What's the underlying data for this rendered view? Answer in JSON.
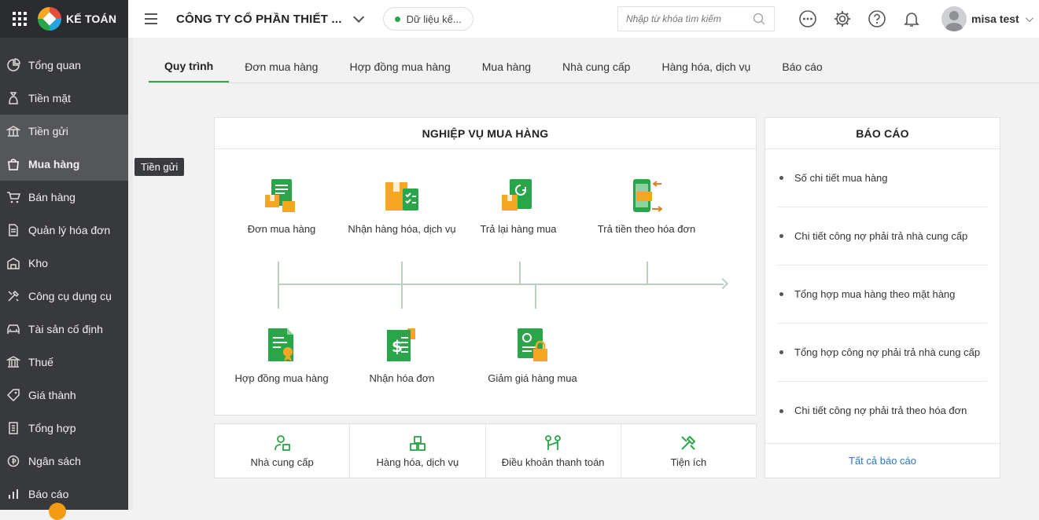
{
  "brand": {
    "name": "KẾ TOÁN"
  },
  "sidebar": {
    "items": [
      {
        "label": "Tổng quan",
        "icon": "chart-pie-icon"
      },
      {
        "label": "Tiền mặt",
        "icon": "money-bag-icon"
      },
      {
        "label": "Tiền gửi",
        "icon": "bank-icon"
      },
      {
        "label": "Mua hàng",
        "icon": "shopping-bag-icon"
      },
      {
        "label": "Bán hàng",
        "icon": "cart-icon"
      },
      {
        "label": "Quản lý hóa đơn",
        "icon": "invoice-icon"
      },
      {
        "label": "Kho",
        "icon": "warehouse-icon"
      },
      {
        "label": "Công cụ dụng cụ",
        "icon": "tools-icon"
      },
      {
        "label": "Tài sản cố định",
        "icon": "car-icon"
      },
      {
        "label": "Thuế",
        "icon": "government-icon"
      },
      {
        "label": "Giá thành",
        "icon": "price-tag-icon"
      },
      {
        "label": "Tổng hợp",
        "icon": "ledger-icon"
      },
      {
        "label": "Ngân sách",
        "icon": "budget-icon"
      },
      {
        "label": "Báo cáo",
        "icon": "bar-chart-icon"
      }
    ],
    "tooltip": "Tiền gửi"
  },
  "header": {
    "company": "CÔNG TY CỔ PHẦN THIẾT ...",
    "data_label": "Dữ liệu kế...",
    "search_placeholder": "Nhập từ khóa tìm kiếm",
    "user_name": "misa test"
  },
  "tabs": [
    "Quy trình",
    "Đơn mua hàng",
    "Hợp đồng mua hàng",
    "Mua hàng",
    "Nhà cung cấp",
    "Hàng hóa, dịch vụ",
    "Báo cáo"
  ],
  "process": {
    "title": "NGHIỆP VỤ MUA HÀNG",
    "top_steps": [
      {
        "label": "Đơn mua hàng"
      },
      {
        "label": "Nhận hàng hóa, dịch vụ"
      },
      {
        "label": "Trả lại hàng mua"
      },
      {
        "label": "Trả tiền theo hóa đơn"
      }
    ],
    "bottom_steps": [
      {
        "label": "Hợp đồng mua hàng"
      },
      {
        "label": "Nhận hóa đơn"
      },
      {
        "label": "Giảm giá hàng mua"
      }
    ]
  },
  "shortcuts": [
    {
      "label": "Nhà cung cấp"
    },
    {
      "label": "Hàng hóa, dịch vụ"
    },
    {
      "label": "Điều khoản thanh toán"
    },
    {
      "label": "Tiện ích"
    }
  ],
  "report": {
    "title": "BÁO CÁO",
    "items": [
      "Số chi tiết mua hàng",
      "Chi tiết công nợ phải trả nhà cung cấp",
      "Tổng hợp mua hàng theo mặt hàng",
      "Tổng hợp công nợ phải trả nhà cung cấp",
      "Chi tiết công nợ phải trả theo hóa đơn"
    ],
    "footer": "Tất cả báo cáo"
  },
  "colors": {
    "accent": "#2aa54a",
    "sidebar": "#38393d",
    "link": "#2b79c2",
    "orange": "#f5a623"
  }
}
